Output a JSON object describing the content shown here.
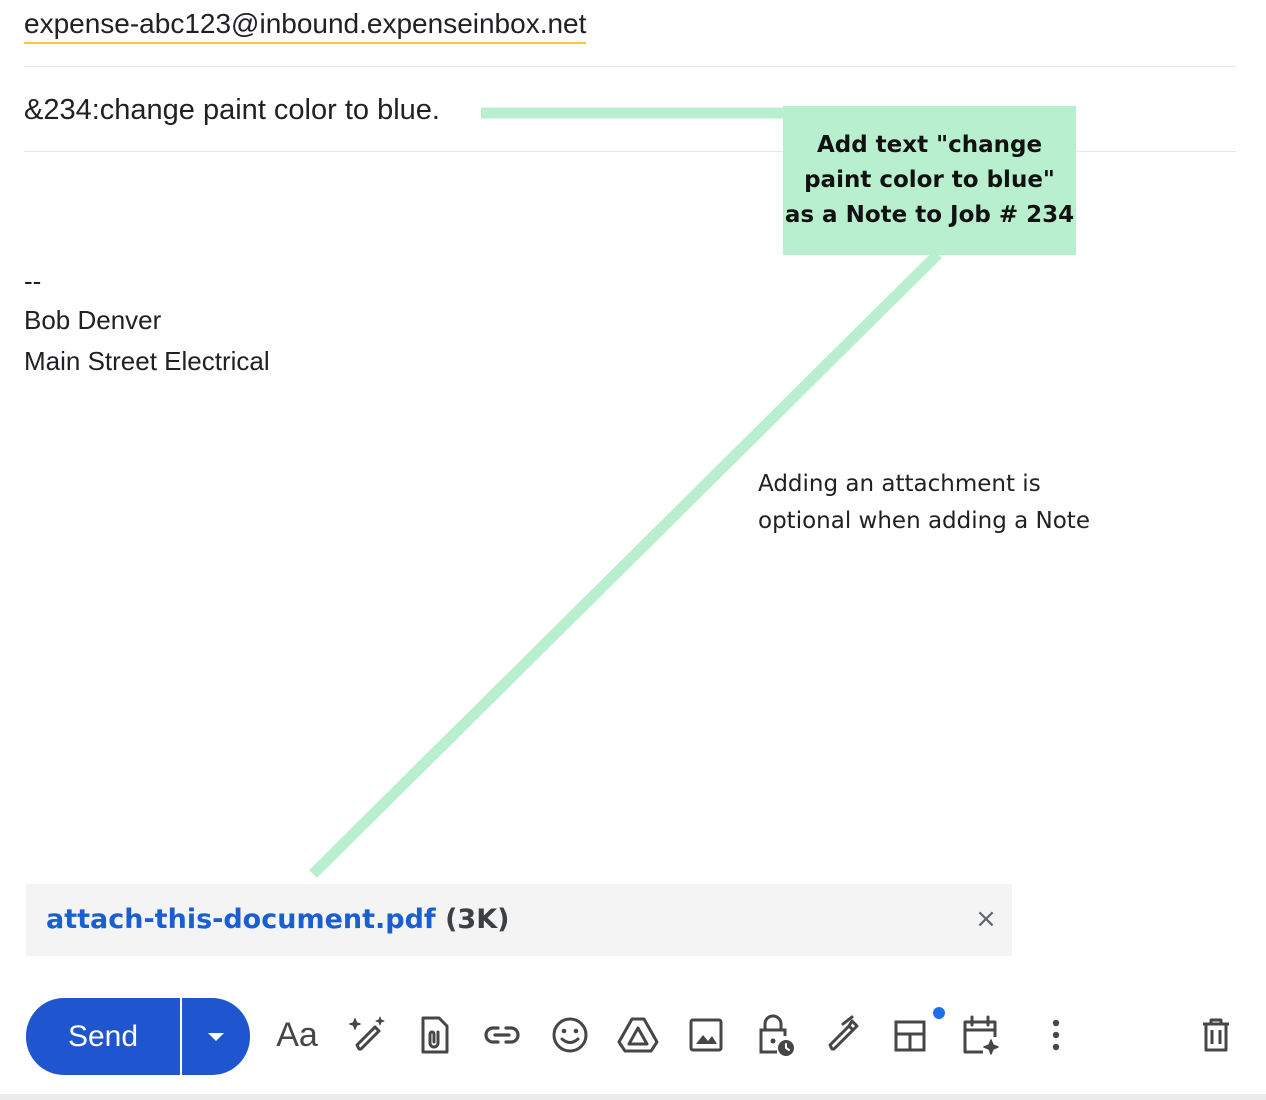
{
  "compose": {
    "recipient": "expense-abc123@inbound.expenseinbox.net",
    "subject": "&234:change paint color to blue.",
    "signature": [
      "--",
      "Bob Denver",
      "Main Street Electrical"
    ]
  },
  "annotations": {
    "callout_lines": [
      "Add text \"change",
      "paint color to blue\"",
      "as a Note to Job # 234"
    ],
    "note_lines": [
      "Adding an attachment is",
      "optional when adding a Note"
    ],
    "line_color": "#b8efcf"
  },
  "attachment": {
    "name": "attach-this-document.pdf",
    "size": "(3K)",
    "close_glyph": "×"
  },
  "toolbar": {
    "send_label": "Send",
    "format_label": "Aa",
    "icons": [
      "formatting-options-icon",
      "help-me-write-icon",
      "attach-files-icon",
      "insert-link-icon",
      "insert-emoji-icon",
      "insert-drive-icon",
      "insert-photo-icon",
      "confidential-mode-icon",
      "insert-signature-icon",
      "layouts-icon",
      "schedule-event-icon",
      "more-options-icon",
      "discard-draft-icon"
    ]
  },
  "colors": {
    "send_button": "#1f56d0",
    "attachment_link": "#1a5fd0",
    "recipient_underline": "#f6c744",
    "notification_dot": "#1f6fe8"
  }
}
